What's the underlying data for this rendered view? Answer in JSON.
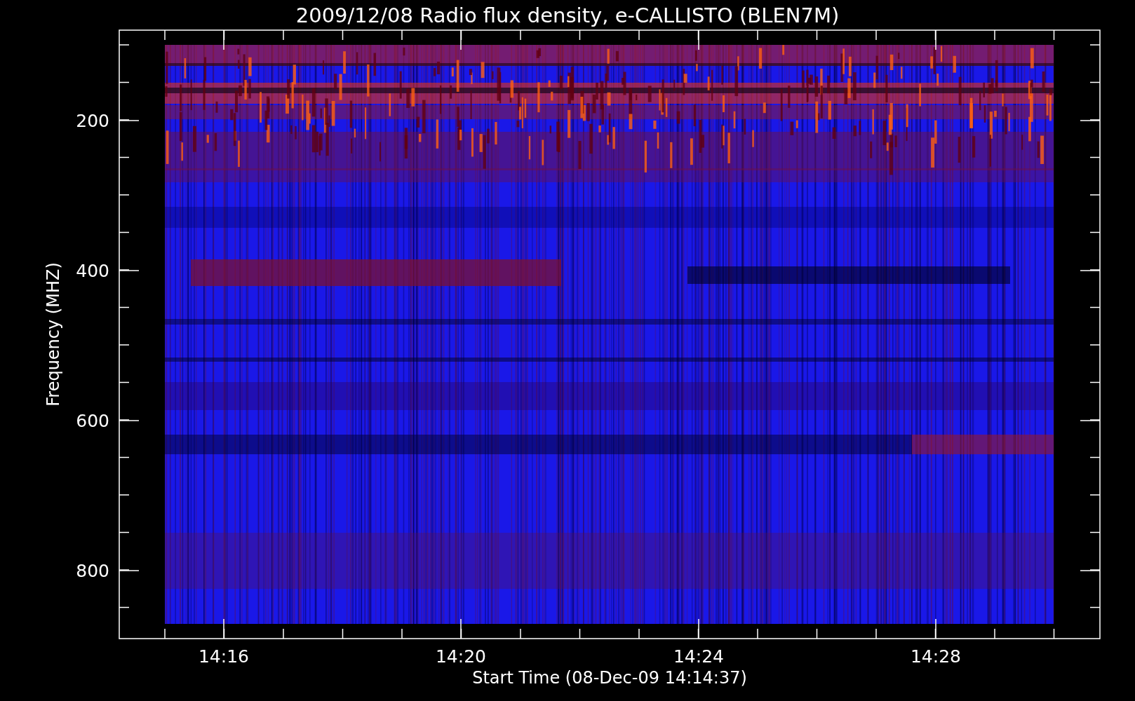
{
  "title": "2009/12/08  Radio flux density, e-CALLISTO (BLEN7M)",
  "y_axis": {
    "label": "Frequency (MHZ)",
    "tick_labels": [
      "200",
      "400",
      "600",
      "800"
    ]
  },
  "x_axis": {
    "label": "Start Time (08-Dec-09 14:14:37)",
    "tick_labels": [
      "14:16",
      "14:20",
      "14:24",
      "14:28"
    ]
  }
}
